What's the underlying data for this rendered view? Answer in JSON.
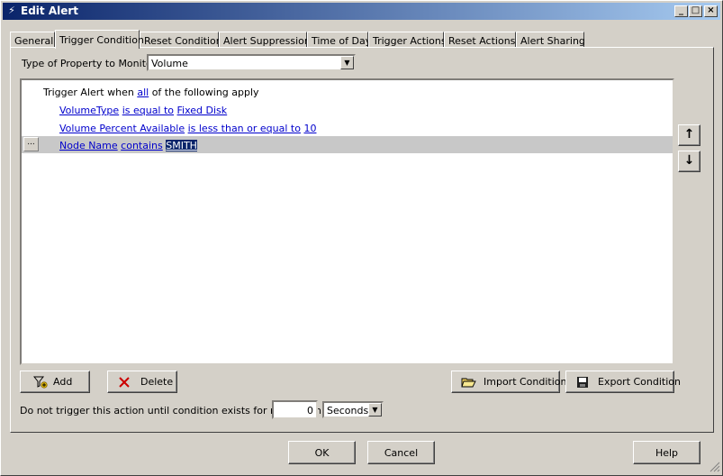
{
  "window": {
    "title": "Edit Alert",
    "icon": "lightning-icon",
    "controls": {
      "minimize": "_",
      "maximize": "□",
      "close": "×"
    }
  },
  "tabs": [
    {
      "label": "General",
      "active": false
    },
    {
      "label": "Trigger Condition",
      "active": true
    },
    {
      "label": "Reset Condition",
      "active": false
    },
    {
      "label": "Alert Suppression",
      "active": false
    },
    {
      "label": "Time of Day",
      "active": false
    },
    {
      "label": "Trigger Actions",
      "active": false
    },
    {
      "label": "Reset Actions",
      "active": false
    },
    {
      "label": "Alert Sharing",
      "active": false
    }
  ],
  "property": {
    "label": "Type of Property to Monitor:",
    "value": "Volume"
  },
  "conditions": {
    "header": {
      "prefix": "Trigger Alert when",
      "scope": "all",
      "suffix": "of the following apply"
    },
    "rows": [
      {
        "field": "VolumeType",
        "operator": "is equal to",
        "value": "Fixed Disk",
        "selected": false
      },
      {
        "field": "Volume Percent Available",
        "operator": "is less than or equal to",
        "value": "10",
        "selected": false
      },
      {
        "field": "Node Name",
        "operator": "contains",
        "value": "SMITH",
        "selected": true,
        "row_button": "..."
      }
    ]
  },
  "buttons": {
    "add": "Add",
    "delete": "Delete",
    "import": "Import Condition",
    "export": "Export Condition",
    "move_up": "↑",
    "move_down": "↓"
  },
  "delay": {
    "label": "Do not trigger this action until condition exists for more than",
    "value": "0",
    "unit": "Seconds"
  },
  "footer": {
    "ok": "OK",
    "cancel": "Cancel",
    "help": "Help"
  },
  "colors": {
    "title_gradient_start": "#0a246a",
    "title_gradient_end": "#a6caf0",
    "link": "#0000cc",
    "selection_highlight": "#0a246a",
    "selected_row": "#c8c8c8",
    "delete_red": "#cc0000"
  }
}
